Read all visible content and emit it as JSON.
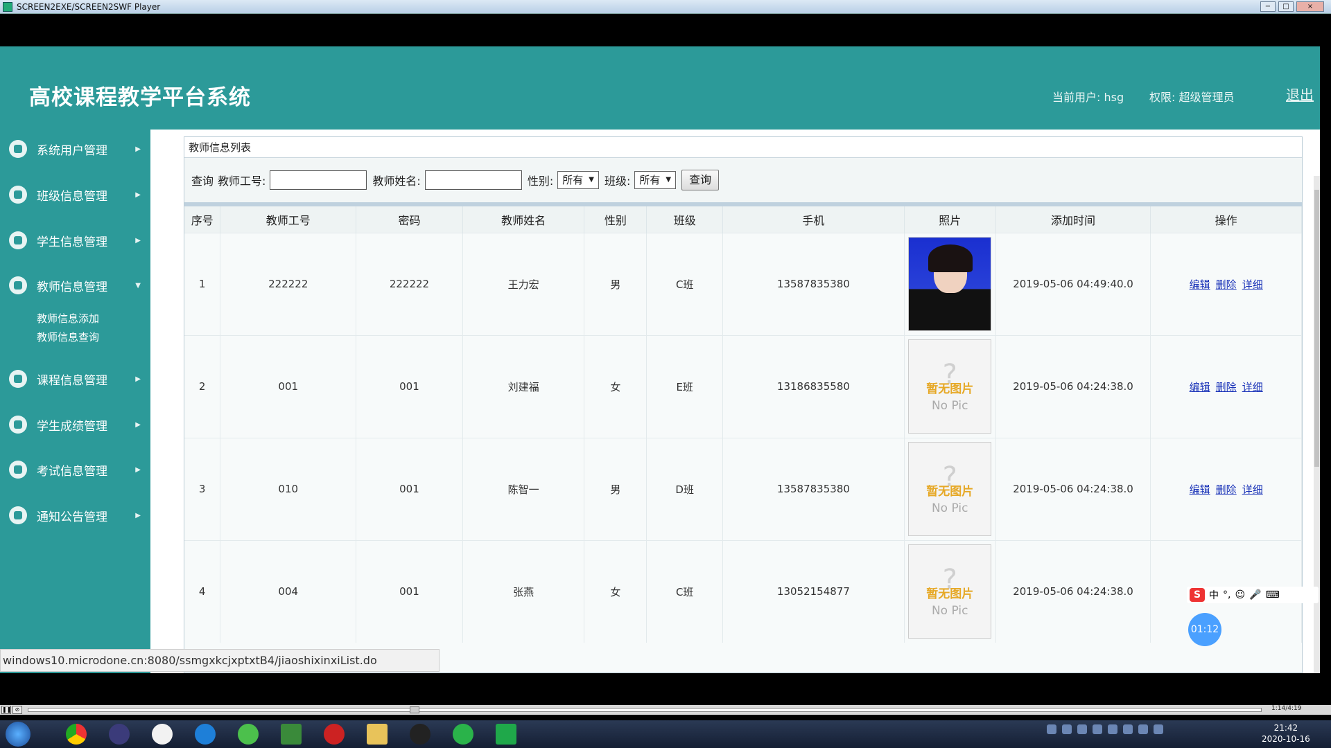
{
  "window": {
    "title": "SCREEN2EXE/SCREEN2SWF Player",
    "minimize": "−",
    "maximize": "□",
    "close": "×"
  },
  "header": {
    "title": "高校课程教学平台系统",
    "current_user": "当前用户: hsg",
    "permission": "权限: 超级管理员",
    "logout": "退出"
  },
  "sidebar": {
    "items": [
      {
        "label": "系统用户管理",
        "icon": "user-icon"
      },
      {
        "label": "班级信息管理",
        "icon": "class-icon"
      },
      {
        "label": "学生信息管理",
        "icon": "student-icon"
      },
      {
        "label": "教师信息管理",
        "icon": "app-icon",
        "expanded": true
      },
      {
        "label": "课程信息管理",
        "icon": "cloud-icon"
      },
      {
        "label": "学生成绩管理",
        "icon": "cloud-icon"
      },
      {
        "label": "考试信息管理",
        "icon": "cloud-icon"
      },
      {
        "label": "通知公告管理",
        "icon": "cloud-icon"
      }
    ],
    "sub_items": [
      "教师信息添加",
      "教师信息查询"
    ]
  },
  "panel": {
    "title": "教师信息列表"
  },
  "search": {
    "query_label": "查询",
    "teacher_id_label": "教师工号:",
    "teacher_id_value": "",
    "teacher_name_label": "教师姓名:",
    "teacher_name_value": "",
    "gender_label": "性别:",
    "gender_value": "所有",
    "class_label": "班级:",
    "class_value": "所有",
    "submit": "查询"
  },
  "table": {
    "columns": [
      "序号",
      "教师工号",
      "密码",
      "教师姓名",
      "性别",
      "班级",
      "手机",
      "照片",
      "添加时间",
      "操作"
    ],
    "rows": [
      {
        "no": "1",
        "id": "222222",
        "password": "222222",
        "name": "王力宏",
        "gender": "男",
        "class": "C班",
        "phone": "13587835380",
        "photo": "real",
        "added": "2019-05-06 04:49:40.0"
      },
      {
        "no": "2",
        "id": "001",
        "password": "001",
        "name": "刘建福",
        "gender": "女",
        "class": "E班",
        "phone": "13186835580",
        "photo": "none",
        "added": "2019-05-06 04:24:38.0"
      },
      {
        "no": "3",
        "id": "010",
        "password": "001",
        "name": "陈智一",
        "gender": "男",
        "class": "D班",
        "phone": "13587835380",
        "photo": "none",
        "added": "2019-05-06 04:24:38.0"
      },
      {
        "no": "4",
        "id": "004",
        "password": "001",
        "name": "张燕",
        "gender": "女",
        "class": "C班",
        "phone": "13052154877",
        "photo": "none",
        "added": "2019-05-06 04:24:38.0"
      }
    ],
    "ops": {
      "edit": "编辑",
      "delete": "删除",
      "detail": "详细"
    },
    "no_pic_zh": "暂无图片",
    "no_pic_en": "No Pic"
  },
  "statusbar": {
    "url": "windows10.microdone.cn:8080/ssmgxkcjxptxtB4/jiaoshixinxiList.do"
  },
  "player": {
    "time": "1:14/4:19"
  },
  "ime": {
    "lang": "中",
    "timer": "01:12"
  },
  "clock": {
    "time": "21:42",
    "date": "2020-10-16"
  }
}
